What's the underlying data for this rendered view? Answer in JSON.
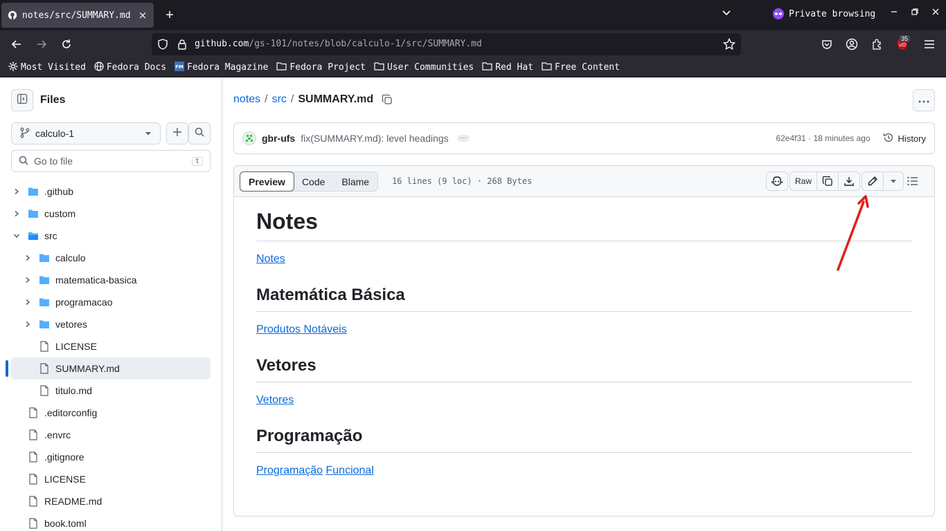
{
  "browser": {
    "tab_title": "notes/src/SUMMARY.md",
    "tab_close": "×",
    "new_tab": "+",
    "private_label": "Private browsing",
    "url_host": "github.com",
    "url_path": "/gs-101/notes/blob/calculo-1/src/SUMMARY.md",
    "extension_badge": "35",
    "bookmarks": [
      "Most Visited",
      "Fedora Docs",
      "Fedora Magazine",
      "Fedora Project",
      "User Communities",
      "Red Hat",
      "Free Content"
    ]
  },
  "sidebar": {
    "title": "Files",
    "branch": "calculo-1",
    "goto_placeholder": "Go to file",
    "goto_shortcut": "t",
    "tree": [
      {
        "label": ".github",
        "type": "folder",
        "level": 0,
        "expanded": false
      },
      {
        "label": "custom",
        "type": "folder",
        "level": 0,
        "expanded": false
      },
      {
        "label": "src",
        "type": "folder",
        "level": 0,
        "expanded": true
      },
      {
        "label": "calculo",
        "type": "folder",
        "level": 1,
        "expanded": false
      },
      {
        "label": "matematica-basica",
        "type": "folder",
        "level": 1,
        "expanded": false
      },
      {
        "label": "programacao",
        "type": "folder",
        "level": 1,
        "expanded": false
      },
      {
        "label": "vetores",
        "type": "folder",
        "level": 1,
        "expanded": false
      },
      {
        "label": "LICENSE",
        "type": "file",
        "level": 1
      },
      {
        "label": "SUMMARY.md",
        "type": "file",
        "level": 1,
        "active": true
      },
      {
        "label": "titulo.md",
        "type": "file",
        "level": 1
      },
      {
        "label": ".editorconfig",
        "type": "file",
        "level": 0
      },
      {
        "label": ".envrc",
        "type": "file",
        "level": 0
      },
      {
        "label": ".gitignore",
        "type": "file",
        "level": 0
      },
      {
        "label": "LICENSE",
        "type": "file",
        "level": 0
      },
      {
        "label": "README.md",
        "type": "file",
        "level": 0
      },
      {
        "label": "book.toml",
        "type": "file",
        "level": 0
      }
    ]
  },
  "breadcrumb": {
    "repo": "notes",
    "dir": "src",
    "file": "SUMMARY.md",
    "sep": "/"
  },
  "commit": {
    "author": "gbr-ufs",
    "message": "fix(SUMMARY.md): level headings",
    "sha_time": "62e4f31 · 18 minutes ago",
    "history_label": "History"
  },
  "file_header": {
    "tabs": [
      "Preview",
      "Code",
      "Blame"
    ],
    "selected_tab": "Preview",
    "info": "16 lines (9 loc) · 268 Bytes",
    "raw_label": "Raw"
  },
  "markdown": {
    "h1": "Notes",
    "link_notes": "Notes",
    "h2_matematica": "Matemática Básica",
    "link_produtos": "Produtos Notáveis",
    "h2_vetores": "Vetores",
    "link_vetores": "Vetores",
    "h2_programacao": "Programação",
    "link_programacao": "Programação",
    "link_funcional": "Funcional"
  },
  "colors": {
    "link": "#0969da",
    "annotation_arrow": "#e0201c",
    "chrome_bg": "#1c1b22"
  }
}
